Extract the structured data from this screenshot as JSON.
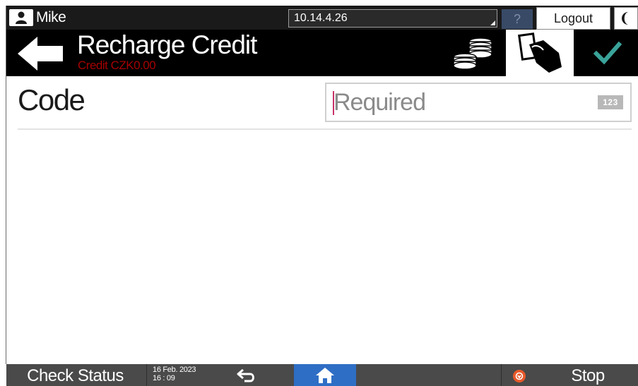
{
  "status_bar": {
    "user_name": "Mike",
    "ip_address": "10.14.4.26",
    "help_label": "?",
    "logout_label": "Logout"
  },
  "header": {
    "title": "Recharge Credit",
    "credit": "Credit CZK0.00"
  },
  "form": {
    "code_label": "Code",
    "code_value": "",
    "code_placeholder": "Required",
    "keypad_badge": "123"
  },
  "bottom_bar": {
    "check_status_label": "Check Status",
    "date": "16 Feb. 2023",
    "time": "16 : 09",
    "stop_label": "Stop"
  },
  "colors": {
    "confirm_check": "#3aa39a",
    "credit_text": "#a50000",
    "home_active": "#2f6ec5",
    "stop_icon": "#e8592a"
  },
  "icons": {
    "user": "user-icon",
    "night_mode": "moon-icon",
    "back": "back-arrow-icon",
    "coins": "coins-icon",
    "card": "card-swipe-icon",
    "confirm": "checkmark-icon",
    "return": "return-arrow-icon",
    "home": "home-icon",
    "stop": "stop-icon"
  }
}
